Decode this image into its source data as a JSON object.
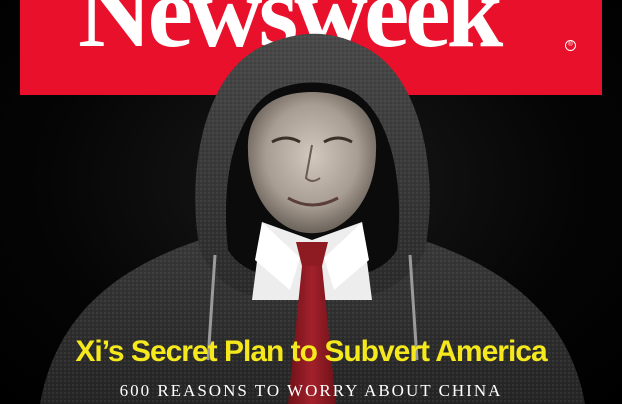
{
  "cover": {
    "masthead": "Newsweek",
    "headline": "Xi’s Secret Plan to Subvert America",
    "subheadline": "600 REASONS TO WORRY ABOUT CHINA"
  },
  "colors": {
    "masthead_red": "#e8102a",
    "headline_yellow": "#f5e81c",
    "background": "#050505",
    "tie_red": "#8e1a22"
  }
}
